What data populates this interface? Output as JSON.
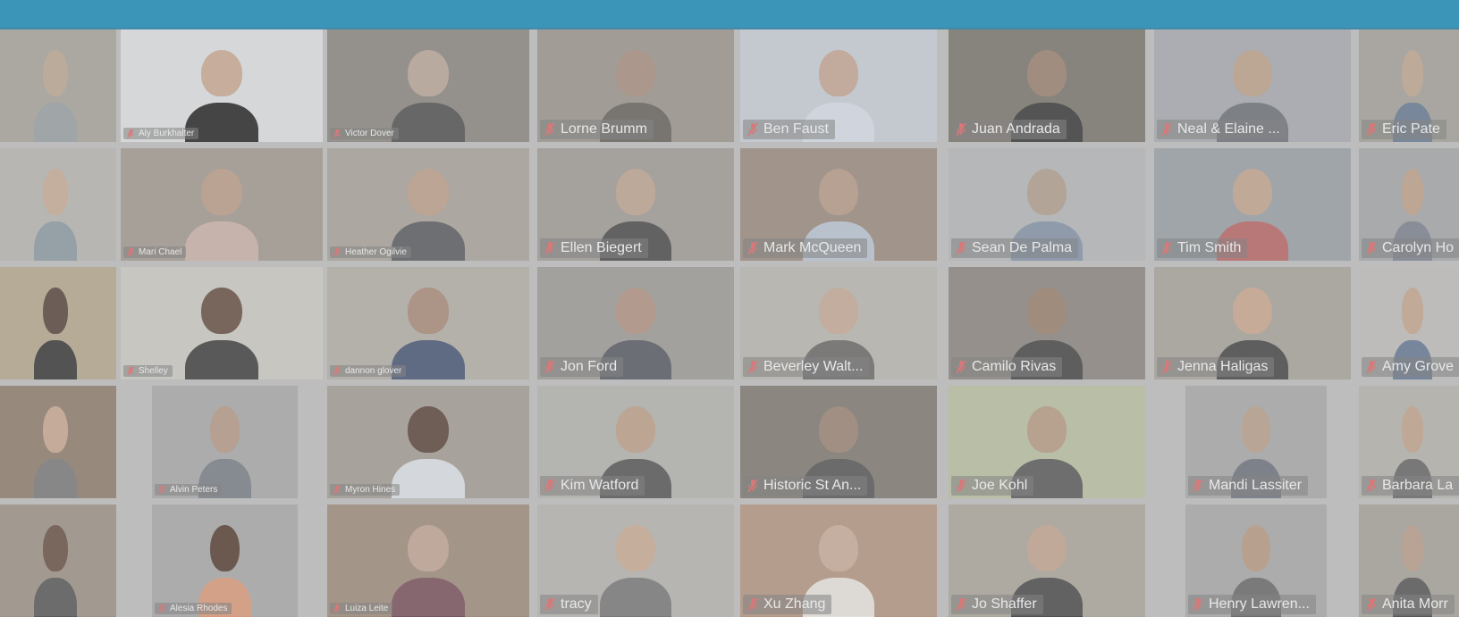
{
  "window": {
    "bar_color": "#1f8db8"
  },
  "participants": [
    {
      "row": 0,
      "col": 0,
      "name": "",
      "bg": "#a7a49c",
      "skin": "#bba894",
      "shirt": "#9aa0a4",
      "label_size": "none"
    },
    {
      "row": 0,
      "col": 1,
      "name": "Aly Burkhalter",
      "bg": "#dcdde0",
      "skin": "#c8aa95",
      "shirt": "#2b2b2b",
      "label_size": "small"
    },
    {
      "row": 0,
      "col": 2,
      "name": "Victor Dover",
      "bg": "#8b8782",
      "skin": "#b9a69a",
      "shirt": "#555555",
      "label_size": "small"
    },
    {
      "row": 0,
      "col": 3,
      "name": "Lorne Brumm",
      "bg": "#9b968e",
      "skin": "#a88f82",
      "shirt": "#6a6560",
      "label_size": "large"
    },
    {
      "row": 0,
      "col": 4,
      "name": "Ben Faust",
      "bg": "#c6ccd3",
      "skin": "#c4a796",
      "shirt": "#d5dbe4",
      "label_size": "large",
      "highlight": "active"
    },
    {
      "row": 0,
      "col": 5,
      "name": "Juan Andrada",
      "bg": "#7c7770",
      "skin": "#9c8373",
      "shirt": "#3e3e3e",
      "label_size": "large"
    },
    {
      "row": 0,
      "col": 6,
      "name": "Neal & Elaine ...",
      "bg": "#a8aab0",
      "skin": "#bca18c",
      "shirt": "#70747a",
      "label_size": "large"
    },
    {
      "row": 0,
      "col": 7,
      "name": "Eric Pate",
      "bg": "#a5a29b",
      "skin": "#bfa791",
      "shirt": "#6b7c93",
      "label_size": "large"
    },
    {
      "row": 1,
      "col": 0,
      "name": "",
      "bg": "#b6b5b0",
      "skin": "#c6ab98",
      "shirt": "#8d9aa3",
      "label_size": "none"
    },
    {
      "row": 1,
      "col": 1,
      "name": "Mari Chael",
      "bg": "#a39a90",
      "skin": "#bb9e8a",
      "shirt": "#c9b2a9",
      "label_size": "small"
    },
    {
      "row": 1,
      "col": 2,
      "name": "Heather Ogilvie",
      "bg": "#a9a39a",
      "skin": "#bca08c",
      "shirt": "#5c5f62",
      "label_size": "small"
    },
    {
      "row": 1,
      "col": 3,
      "name": "Ellen Biegert",
      "bg": "#a09b96",
      "skin": "#bda593",
      "shirt": "#4f4f4f",
      "label_size": "large"
    },
    {
      "row": 1,
      "col": 4,
      "name": "Mark McQueen",
      "bg": "#9a8b80",
      "skin": "#b59b89",
      "shirt": "#b9c3d0",
      "label_size": "large"
    },
    {
      "row": 1,
      "col": 5,
      "name": "Sean De Palma",
      "bg": "#b4b6b8",
      "skin": "#b19f91",
      "shirt": "#8594a8",
      "label_size": "large"
    },
    {
      "row": 1,
      "col": 6,
      "name": "Tim Smith",
      "bg": "#9aa0a6",
      "skin": "#c2a591",
      "shirt": "#b8696a",
      "label_size": "large"
    },
    {
      "row": 1,
      "col": 7,
      "name": "Carolyn Ho",
      "bg": "#a5a6a8",
      "skin": "#bfa18d",
      "shirt": "#7d8390",
      "label_size": "large"
    },
    {
      "row": 2,
      "col": 0,
      "name": "",
      "bg": "#b5a88e",
      "skin": "#5b4a40",
      "shirt": "#3c3c3c",
      "label_size": "none",
      "highlight": "pinned"
    },
    {
      "row": 2,
      "col": 1,
      "name": "Shelley",
      "bg": "#cbc9c3",
      "skin": "#6a5447",
      "shirt": "#444444",
      "label_size": "small"
    },
    {
      "row": 2,
      "col": 2,
      "name": "dannon glover",
      "bg": "#b2aea6",
      "skin": "#a98c7a",
      "shirt": "#4b5a77",
      "label_size": "small"
    },
    {
      "row": 2,
      "col": 3,
      "name": "Jon Ford",
      "bg": "#9e9b96",
      "skin": "#b09484",
      "shirt": "#5a5d64",
      "label_size": "large"
    },
    {
      "row": 2,
      "col": 4,
      "name": "Beverley Walt...",
      "bg": "#b8b6b0",
      "skin": "#c4aa98",
      "shirt": "#6d6c6a",
      "label_size": "large"
    },
    {
      "row": 2,
      "col": 5,
      "name": "Camilo Rivas",
      "bg": "#8d8780",
      "skin": "#9a8270",
      "shirt": "#4a4a4a",
      "label_size": "large"
    },
    {
      "row": 2,
      "col": 6,
      "name": "Jenna Haligas",
      "bg": "#a8a39b",
      "skin": "#c9a891",
      "shirt": "#4a4a4a",
      "label_size": "large"
    },
    {
      "row": 2,
      "col": 7,
      "name": "Amy Grove",
      "bg": "#bdbcba",
      "skin": "#c3a691",
      "shirt": "#6a7b95",
      "label_size": "large"
    },
    {
      "row": 3,
      "col": 0,
      "name": "",
      "bg": "#8f7e6e",
      "skin": "#c6a893",
      "shirt": "#7c7c7c",
      "label_size": "none"
    },
    {
      "row": 3,
      "col": 1,
      "name": "Alvin Peters",
      "bg": "#a9a9a9",
      "skin": "#b49a88",
      "shirt": "#7a8088",
      "label_size": "small",
      "inset": "narrow"
    },
    {
      "row": 3,
      "col": 2,
      "name": "Myron Hines",
      "bg": "#a39d95",
      "skin": "#5e4a3f",
      "shirt": "#d9dde2",
      "label_size": "small"
    },
    {
      "row": 3,
      "col": 3,
      "name": "Kim Watford",
      "bg": "#b3b2ae",
      "skin": "#bda08c",
      "shirt": "#595959",
      "label_size": "large"
    },
    {
      "row": 3,
      "col": 4,
      "name": "Historic St An...",
      "bg": "#807a73",
      "skin": "#9a8576",
      "shirt": "#5a5a5a",
      "label_size": "large"
    },
    {
      "row": 3,
      "col": 5,
      "name": "Joe Kohl",
      "bg": "#b9bfa2",
      "skin": "#b69b85",
      "shirt": "#5d5d5d",
      "label_size": "large"
    },
    {
      "row": 3,
      "col": 6,
      "name": "Mandi Lassiter",
      "bg": "#a9a9a9",
      "skin": "#b8a08d",
      "shirt": "#6f757e",
      "label_size": "large",
      "inset": "narrow"
    },
    {
      "row": 3,
      "col": 7,
      "name": "Barbara La",
      "bg": "#b4b2ac",
      "skin": "#c1a48f",
      "shirt": "#6a6a6a",
      "label_size": "large"
    },
    {
      "row": 4,
      "col": 0,
      "name": "",
      "bg": "#9d9287",
      "skin": "#6b5548",
      "shirt": "#5b5b5b",
      "label_size": "none"
    },
    {
      "row": 4,
      "col": 1,
      "name": "Alesia Rhodes",
      "bg": "#a9a9a9",
      "skin": "#5a4438",
      "shirt": "#d89b7c",
      "label_size": "small",
      "inset": "narrow"
    },
    {
      "row": 4,
      "col": 2,
      "name": "Luiza Leite",
      "bg": "#9f8d7e",
      "skin": "#c0a595",
      "shirt": "#7a5560",
      "label_size": "small"
    },
    {
      "row": 4,
      "col": 3,
      "name": "tracy",
      "bg": "#b5b4b0",
      "skin": "#c8ab97",
      "shirt": "#7a7a7a",
      "label_size": "large"
    },
    {
      "row": 4,
      "col": 4,
      "name": "Xu Zhang",
      "bg": "#b49683",
      "skin": "#c7ad9c",
      "shirt": "#e4e1dc",
      "label_size": "large"
    },
    {
      "row": 4,
      "col": 5,
      "name": "Jo Shaffer",
      "bg": "#aba69c",
      "skin": "#c1a592",
      "shirt": "#4f4f4f",
      "label_size": "large"
    },
    {
      "row": 4,
      "col": 6,
      "name": "Henry Lawren...",
      "bg": "#a9a9a9",
      "skin": "#b79a86",
      "shirt": "#6c6c6c",
      "label_size": "large",
      "inset": "narrow"
    },
    {
      "row": 4,
      "col": 7,
      "name": "Anita Morr",
      "bg": "#a7a39c",
      "skin": "#b89e8c",
      "shirt": "#5a5a5a",
      "label_size": "large"
    }
  ]
}
